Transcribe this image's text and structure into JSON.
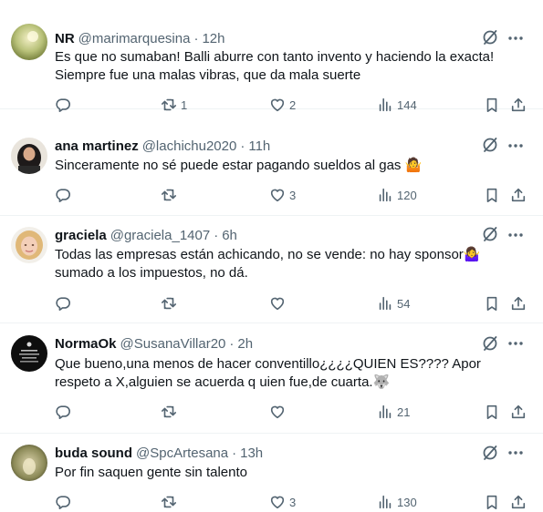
{
  "tweets": [
    {
      "name": "NR",
      "handle": "@marimarquesina",
      "time": "12h",
      "lines": [
        "Es que no sumaban! Balli aburre con tanto invento y haciendo la exacta!",
        "Siempre fue una  malas vibras, que da mala suerte"
      ],
      "reposts": "1",
      "likes": "2",
      "views": "144"
    },
    {
      "name": "ana martinez",
      "handle": "@lachichu2020",
      "time": "11h",
      "lines": [
        "Sinceramente no sé puede estar pagando sueldos al gas 🤷"
      ],
      "reposts": "",
      "likes": "3",
      "views": "120"
    },
    {
      "name": "graciela",
      "handle": "@graciela_1407",
      "time": "6h",
      "lines": [
        "Todas las empresas están achicando, no se vende: no hay sponsor🤷‍♀️",
        "sumado a los impuestos,  no dá."
      ],
      "reposts": "",
      "likes": "",
      "views": "54"
    },
    {
      "name": "NormaOk",
      "handle": "@SusanaVillar20",
      "time": "2h",
      "lines": [
        "Que bueno,una menos de hacer conventillo¿¿¿¿QUIEN ES???? Apor",
        "respeto a X,alguien se acuerda q uien fue,de cuarta.🐺"
      ],
      "reposts": "",
      "likes": "",
      "views": "21"
    },
    {
      "name": "buda sound",
      "handle": "@SpcArtesana",
      "time": "13h",
      "lines": [
        "Por fin saquen gente sin talento"
      ],
      "reposts": "",
      "likes": "3",
      "views": "130"
    }
  ],
  "separator": "·",
  "icons": {
    "reply": "reply-icon",
    "repost": "repost-icon",
    "like": "heart-icon",
    "views": "views-icon",
    "bookmark": "bookmark-icon",
    "share": "share-icon",
    "grok": "grok-icon",
    "more": "more-icon"
  },
  "colors": {
    "text": "#0f1419",
    "secondary": "#536471",
    "divider": "#eff3f4"
  }
}
